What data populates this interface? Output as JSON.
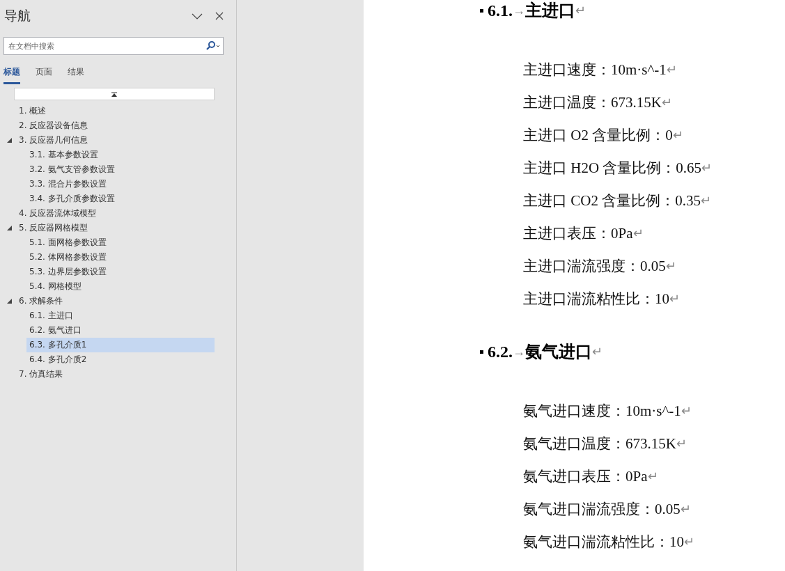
{
  "nav": {
    "title": "导航",
    "search": {
      "placeholder": "在文档中搜索"
    },
    "tabs": [
      {
        "label": "标题",
        "selected": true
      },
      {
        "label": "页面",
        "selected": false
      },
      {
        "label": "结果",
        "selected": false
      }
    ],
    "tree": [
      {
        "label": "1. 概述",
        "selected": false
      },
      {
        "label": "2. 反应器设备信息",
        "selected": false
      },
      {
        "label": "3. 反应器几何信息",
        "selected": false,
        "expanded": true,
        "children": [
          {
            "label": "3.1. 基本参数设置",
            "selected": false
          },
          {
            "label": "3.2. 氨气支管参数设置",
            "selected": false
          },
          {
            "label": "3.3. 混合片参数设置",
            "selected": false
          },
          {
            "label": "3.4. 多孔介质参数设置",
            "selected": false
          }
        ]
      },
      {
        "label": "4. 反应器流体域模型",
        "selected": false
      },
      {
        "label": "5. 反应器网格模型",
        "selected": false,
        "expanded": true,
        "children": [
          {
            "label": "5.1. 面网格参数设置",
            "selected": false
          },
          {
            "label": "5.2. 体网格参数设置",
            "selected": false
          },
          {
            "label": "5.3. 边界层参数设置",
            "selected": false
          },
          {
            "label": "5.4. 网格模型",
            "selected": false
          }
        ]
      },
      {
        "label": "6. 求解条件",
        "selected": false,
        "expanded": true,
        "children": [
          {
            "label": "6.1. 主进口",
            "selected": false
          },
          {
            "label": "6.2. 氨气进口",
            "selected": false
          },
          {
            "label": "6.3. 多孔介质1",
            "selected": true
          },
          {
            "label": "6.4. 多孔介质2",
            "selected": false
          }
        ]
      },
      {
        "label": "7. 仿真结果",
        "selected": false
      }
    ]
  },
  "document": {
    "sections": [
      {
        "number": "6.1.",
        "tab_mark": "→",
        "title": "主进口",
        "para_mark": "↵",
        "lines": [
          {
            "text": "主进口速度：10m·s^-1",
            "mark": "↵"
          },
          {
            "text": "主进口温度：673.15K",
            "mark": "↵"
          },
          {
            "text": "主进口 O2 含量比例：0",
            "mark": "↵"
          },
          {
            "text": "主进口 H2O 含量比例：0.65",
            "mark": "↵"
          },
          {
            "text": "主进口 CO2 含量比例：0.35",
            "mark": "↵"
          },
          {
            "text": "主进口表压：0Pa",
            "mark": "↵"
          },
          {
            "text": "主进口湍流强度：0.05",
            "mark": "↵"
          },
          {
            "text": "主进口湍流粘性比：10",
            "mark": "↵"
          }
        ]
      },
      {
        "number": "6.2.",
        "tab_mark": "→",
        "title": "氨气进口",
        "para_mark": "↵",
        "lines": [
          {
            "text": "氨气进口速度：10m·s^-1",
            "mark": "↵"
          },
          {
            "text": "氨气进口温度：673.15K",
            "mark": "↵"
          },
          {
            "text": "氨气进口表压：0Pa",
            "mark": "↵"
          },
          {
            "text": "氨气进口湍流强度：0.05",
            "mark": "↵"
          },
          {
            "text": "氨气进口湍流粘性比：10",
            "mark": "↵"
          }
        ]
      }
    ]
  }
}
